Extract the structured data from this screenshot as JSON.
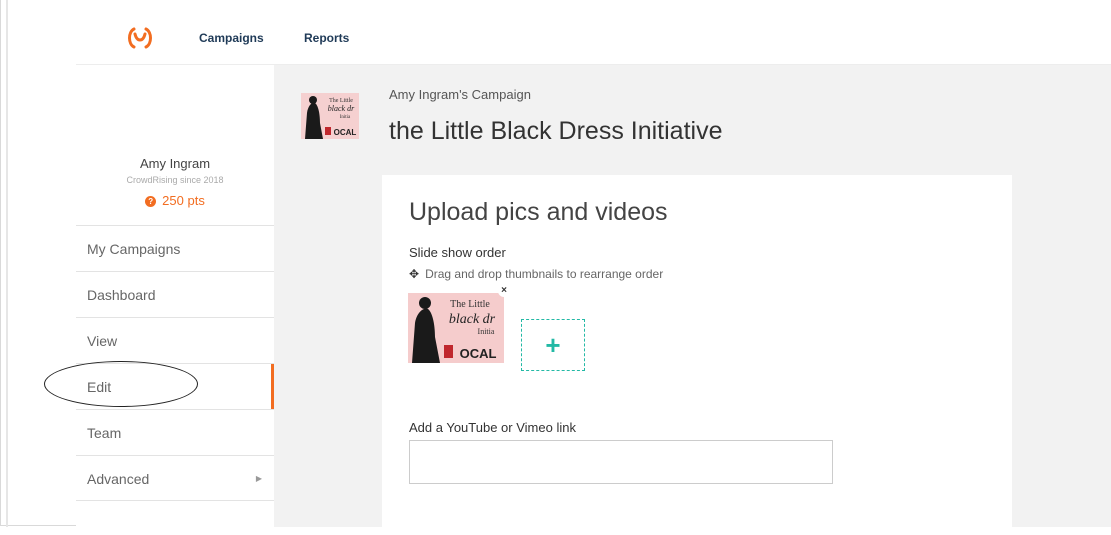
{
  "nav": {
    "logo_icon": "crowdrise-logo-icon",
    "campaigns": "Campaigns",
    "reports": "Reports"
  },
  "profile": {
    "name": "Amy Ingram",
    "since": "CrowdRising since 2018",
    "points": "250 pts",
    "points_icon": "points-icon"
  },
  "sidebar": {
    "items": [
      {
        "label": "My Campaigns"
      },
      {
        "label": "Dashboard"
      },
      {
        "label": "View"
      },
      {
        "label": "Edit",
        "active": true
      },
      {
        "label": "Team"
      },
      {
        "label": "Advanced",
        "has_arrow": true
      }
    ]
  },
  "campaign": {
    "owner": "Amy Ingram's Campaign",
    "title": "the Little Black Dress Initiative"
  },
  "upload": {
    "title": "Upload pics and videos",
    "slide_label": "Slide show order",
    "drag_hint": "Drag and drop thumbnails to rearrange order",
    "thumb_text": [
      "The Little",
      "black dr",
      "Initia",
      "OCAL"
    ],
    "small_thumb_text": [
      "The Little",
      "black dr",
      "Initia",
      "OCAL"
    ],
    "add_symbol": "+",
    "close_symbol": "×",
    "video_label": "Add a YouTube or Vimeo link",
    "video_value": ""
  },
  "colors": {
    "accent": "#f26d21",
    "teal": "#23b9a5",
    "nav_text": "#1f3a57"
  }
}
